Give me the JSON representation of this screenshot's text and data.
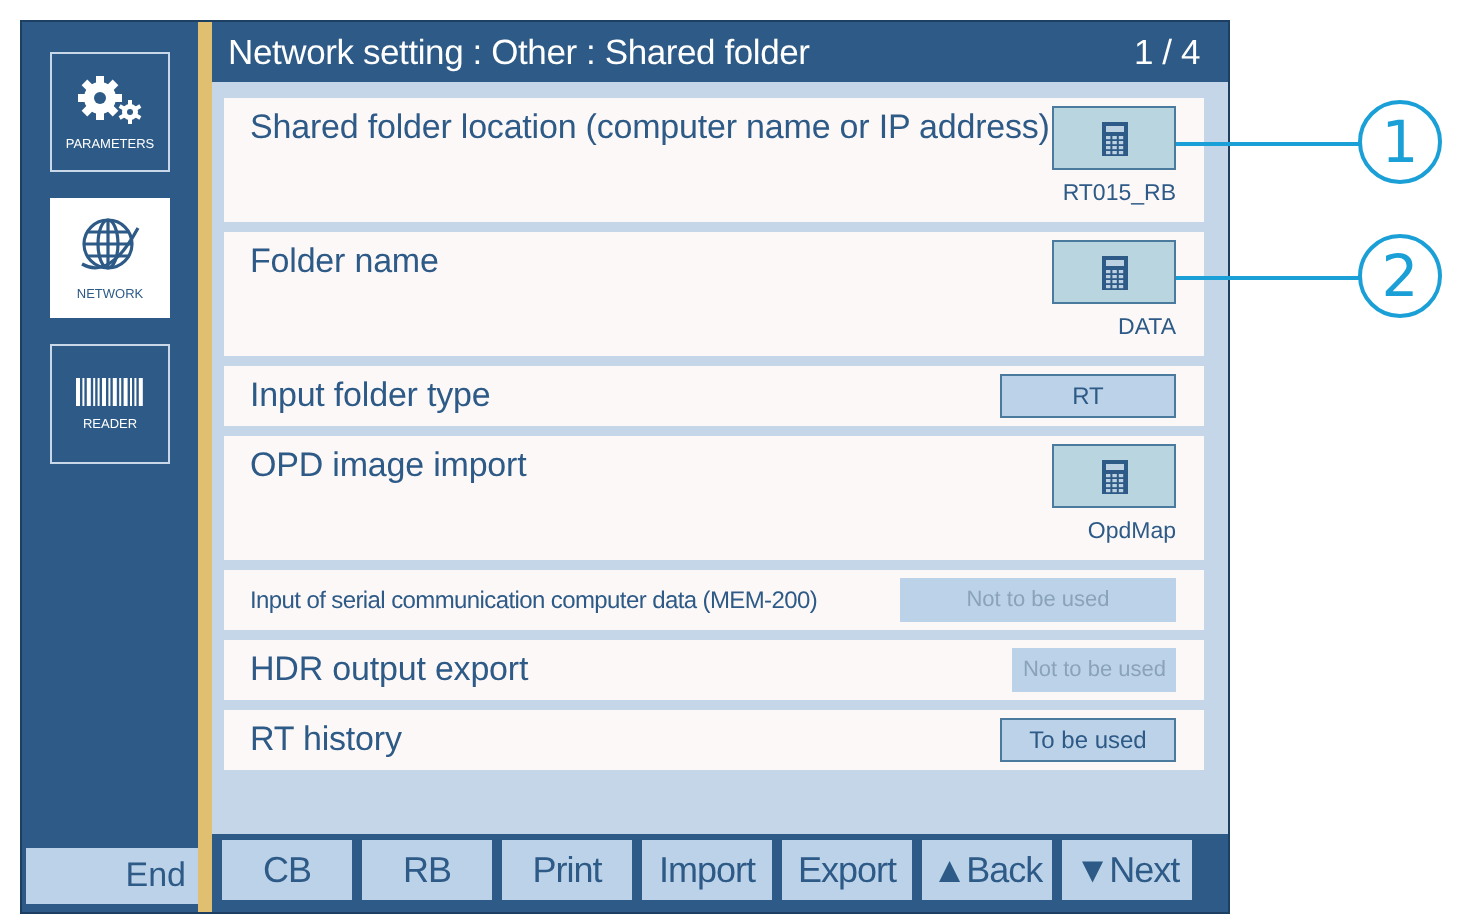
{
  "sidebar": {
    "items": [
      {
        "kind": "gears",
        "label": "PARAMETERS",
        "selected": false
      },
      {
        "kind": "globe",
        "label": "NETWORK",
        "selected": true
      },
      {
        "kind": "barcode",
        "label": "READER",
        "selected": false
      }
    ],
    "end_button": "End"
  },
  "title": {
    "text": "Network setting : Other : Shared folder",
    "page": "1 / 4"
  },
  "rows": [
    {
      "kind": "calculator",
      "label": "Shared folder location (computer name or IP address)",
      "value": "RT015_RB",
      "callout": "1"
    },
    {
      "kind": "calculator",
      "label": "Folder name",
      "value": "DATA",
      "callout": "2"
    },
    {
      "kind": "select",
      "label": "Input folder type",
      "value": "RT",
      "disabled": false
    },
    {
      "kind": "calculator",
      "label": "OPD image import",
      "value": "OpdMap"
    },
    {
      "kind": "select-long",
      "label": "Input of serial communication computer data (MEM-200)",
      "value": "Not to be used",
      "disabled": true
    },
    {
      "kind": "select",
      "label": "HDR output export",
      "value": "Not to be used",
      "disabled": true
    },
    {
      "kind": "select",
      "label": "RT history",
      "value": "To be used",
      "disabled": false
    }
  ],
  "footer": [
    "CB",
    "RB",
    "Print",
    "Import",
    "Export",
    "▲Back",
    "▼Next"
  ]
}
